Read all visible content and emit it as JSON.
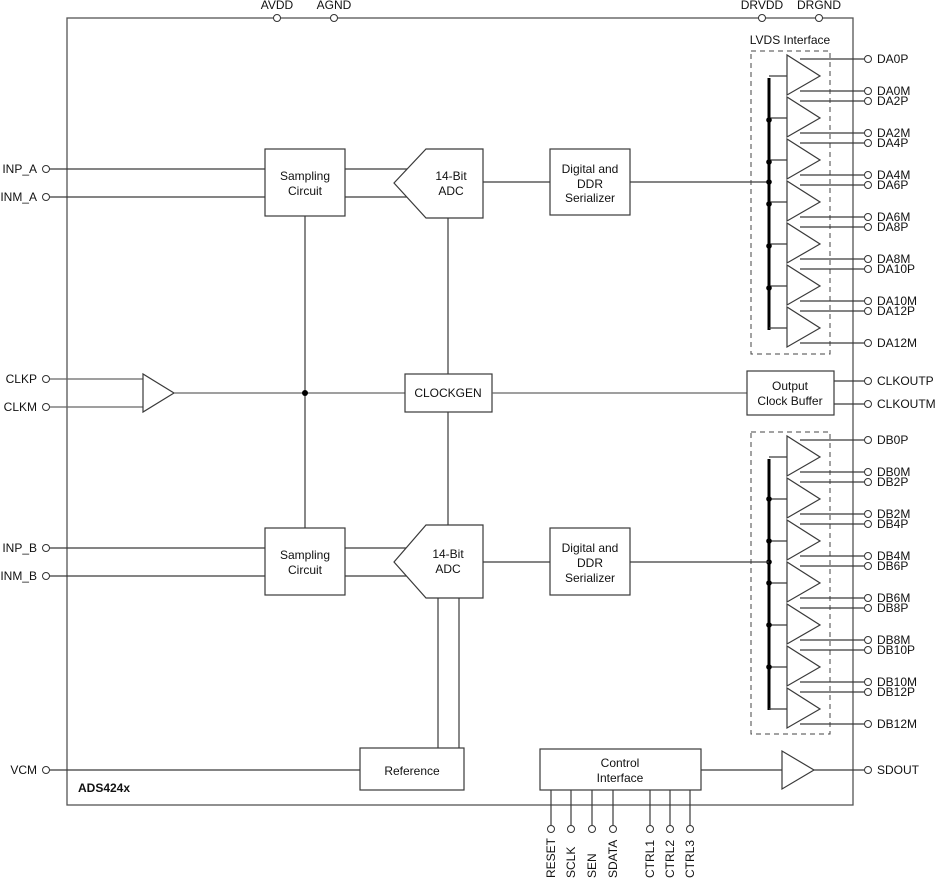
{
  "device": {
    "name": "ADS424x"
  },
  "power_pins": [
    "AVDD",
    "AGND",
    "DRVDD",
    "DRGND"
  ],
  "channel_a": {
    "inputs": [
      "INP_A",
      "INM_A"
    ],
    "sampling": [
      "Sampling",
      "Circuit"
    ],
    "adc": [
      "14-Bit",
      "ADC"
    ],
    "serializer": [
      "Digital and",
      "DDR",
      "Serializer"
    ],
    "outputs": [
      "DA0P",
      "DA0M",
      "DA2P",
      "DA2M",
      "DA4P",
      "DA4M",
      "DA6P",
      "DA6M",
      "DA8P",
      "DA8M",
      "DA10P",
      "DA10M",
      "DA12P",
      "DA12M"
    ]
  },
  "channel_b": {
    "inputs": [
      "INP_B",
      "INM_B"
    ],
    "sampling": [
      "Sampling",
      "Circuit"
    ],
    "adc": [
      "14-Bit",
      "ADC"
    ],
    "serializer": [
      "Digital and",
      "DDR",
      "Serializer"
    ],
    "outputs": [
      "DB0P",
      "DB0M",
      "DB2P",
      "DB2M",
      "DB4P",
      "DB4M",
      "DB6P",
      "DB6M",
      "DB8P",
      "DB8M",
      "DB10P",
      "DB10M",
      "DB12P",
      "DB12M"
    ]
  },
  "lvds_label": "LVDS Interface",
  "clock": {
    "inputs": [
      "CLKP",
      "CLKM"
    ],
    "clockgen": "CLOCKGEN",
    "output_buffer": [
      "Output",
      "Clock Buffer"
    ],
    "outputs": [
      "CLKOUTP",
      "CLKOUTM"
    ]
  },
  "reference": {
    "label": "Reference",
    "pin": "VCM"
  },
  "control": {
    "label": [
      "Control",
      "Interface"
    ],
    "pins": [
      "RESET",
      "SCLK",
      "SEN",
      "SDATA",
      "CTRL1",
      "CTRL2",
      "CTRL3"
    ],
    "output": "SDOUT"
  }
}
